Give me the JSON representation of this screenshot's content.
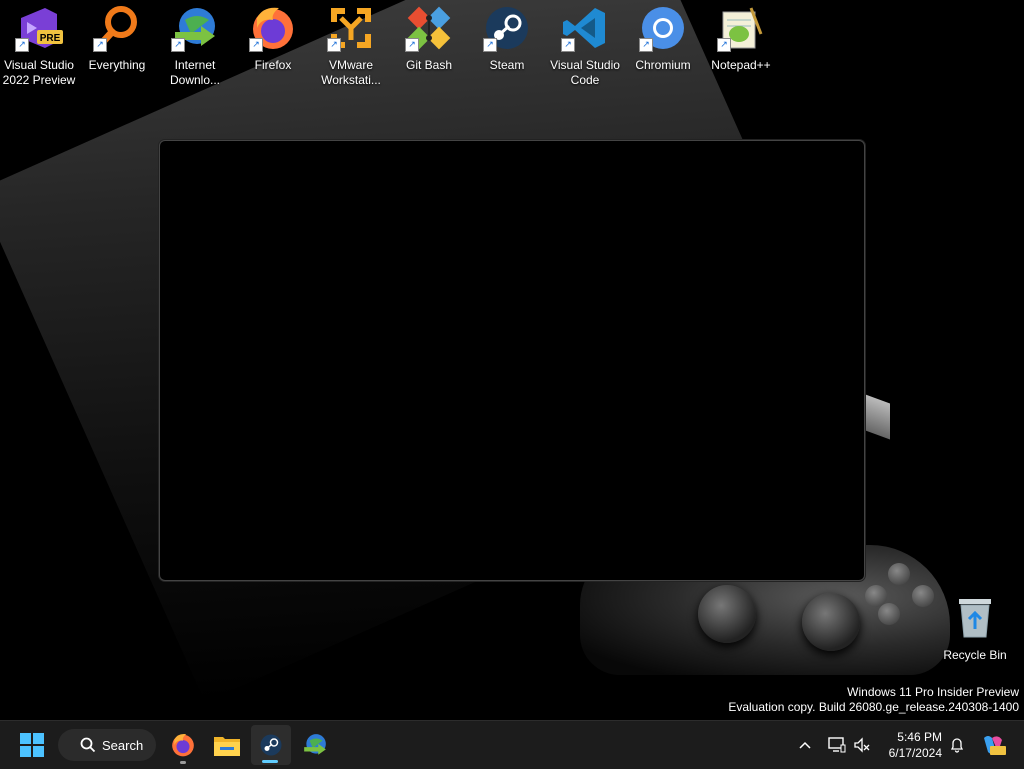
{
  "desktop": {
    "icons": [
      {
        "label": "Visual Studio\n2022 Preview",
        "icon": "visual-studio-preview-icon"
      },
      {
        "label": "Everything",
        "icon": "everything-search-icon"
      },
      {
        "label": "Internet\nDownlo...",
        "icon": "internet-download-manager-icon"
      },
      {
        "label": "Firefox",
        "icon": "firefox-icon"
      },
      {
        "label": "VMware\nWorkstati...",
        "icon": "vmware-icon"
      },
      {
        "label": "Git Bash",
        "icon": "git-bash-icon"
      },
      {
        "label": "Steam",
        "icon": "steam-icon"
      },
      {
        "label": "Visual Studio\nCode",
        "icon": "vscode-icon"
      },
      {
        "label": "Chromium",
        "icon": "chromium-icon"
      },
      {
        "label": "Notepad++",
        "icon": "notepad-plus-plus-icon"
      }
    ],
    "recycle_bin": "Recycle Bin",
    "watermark": {
      "line1": "Windows 11 Pro Insider Preview",
      "line2": "Evaluation copy. Build 26080.ge_release.240308-1400"
    }
  },
  "taskbar": {
    "search_label": "Search",
    "time": "5:46 PM",
    "date": "6/17/2024",
    "pinned": [
      "firefox-icon",
      "file-explorer-icon",
      "steam-icon",
      "internet-download-manager-icon"
    ],
    "accent": "#60cdff"
  }
}
